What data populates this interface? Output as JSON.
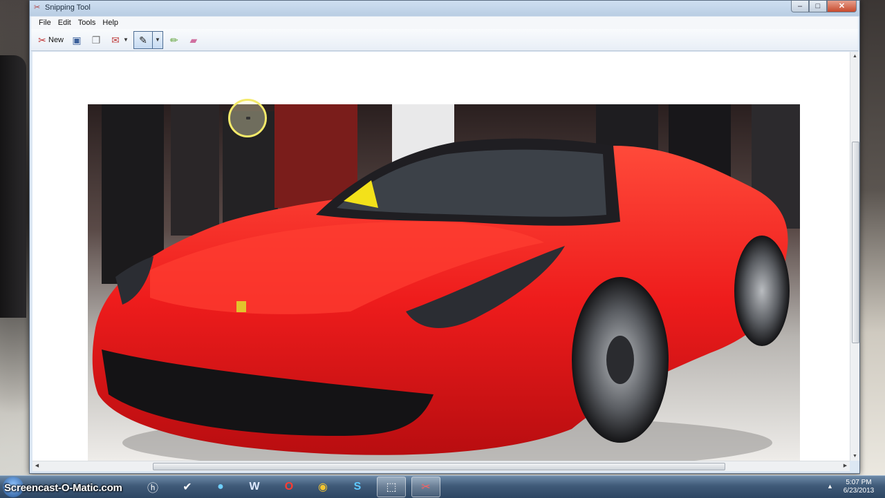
{
  "window": {
    "title": "Snipping Tool",
    "controls": {
      "minimize": "–",
      "maximize": "□",
      "close": "✕"
    }
  },
  "menu": [
    "File",
    "Edit",
    "Tools",
    "Help"
  ],
  "toolbar": {
    "new_label": "New",
    "new_icon": "scissors-icon",
    "save_icon": "save-icon",
    "copy_icon": "copy-icon",
    "send_icon": "send-snip-icon",
    "pen_icon": "pen-icon",
    "highlighter_icon": "highlighter-icon",
    "eraser_icon": "eraser-icon"
  },
  "photo": {
    "subject": "Red Ferrari 458 Spider at auto show",
    "main_color": "#ee1c1c"
  },
  "taskbar": {
    "watermark": "Screencast-O-Matic.com",
    "apps": [
      {
        "name": "hp-icon",
        "glyph": "ⓗ"
      },
      {
        "name": "check-icon",
        "glyph": "✔"
      },
      {
        "name": "globe-icon",
        "glyph": "●"
      },
      {
        "name": "word-icon",
        "glyph": "W"
      },
      {
        "name": "opera-icon",
        "glyph": "O"
      },
      {
        "name": "chrome-icon",
        "glyph": "◉"
      },
      {
        "name": "skype-icon",
        "glyph": "S"
      },
      {
        "name": "snipping-icon",
        "glyph": "⬚"
      },
      {
        "name": "snipping-tool-active-icon",
        "glyph": "✂"
      }
    ],
    "clock_time": "5:07 PM",
    "clock_date": "6/23/2013"
  }
}
